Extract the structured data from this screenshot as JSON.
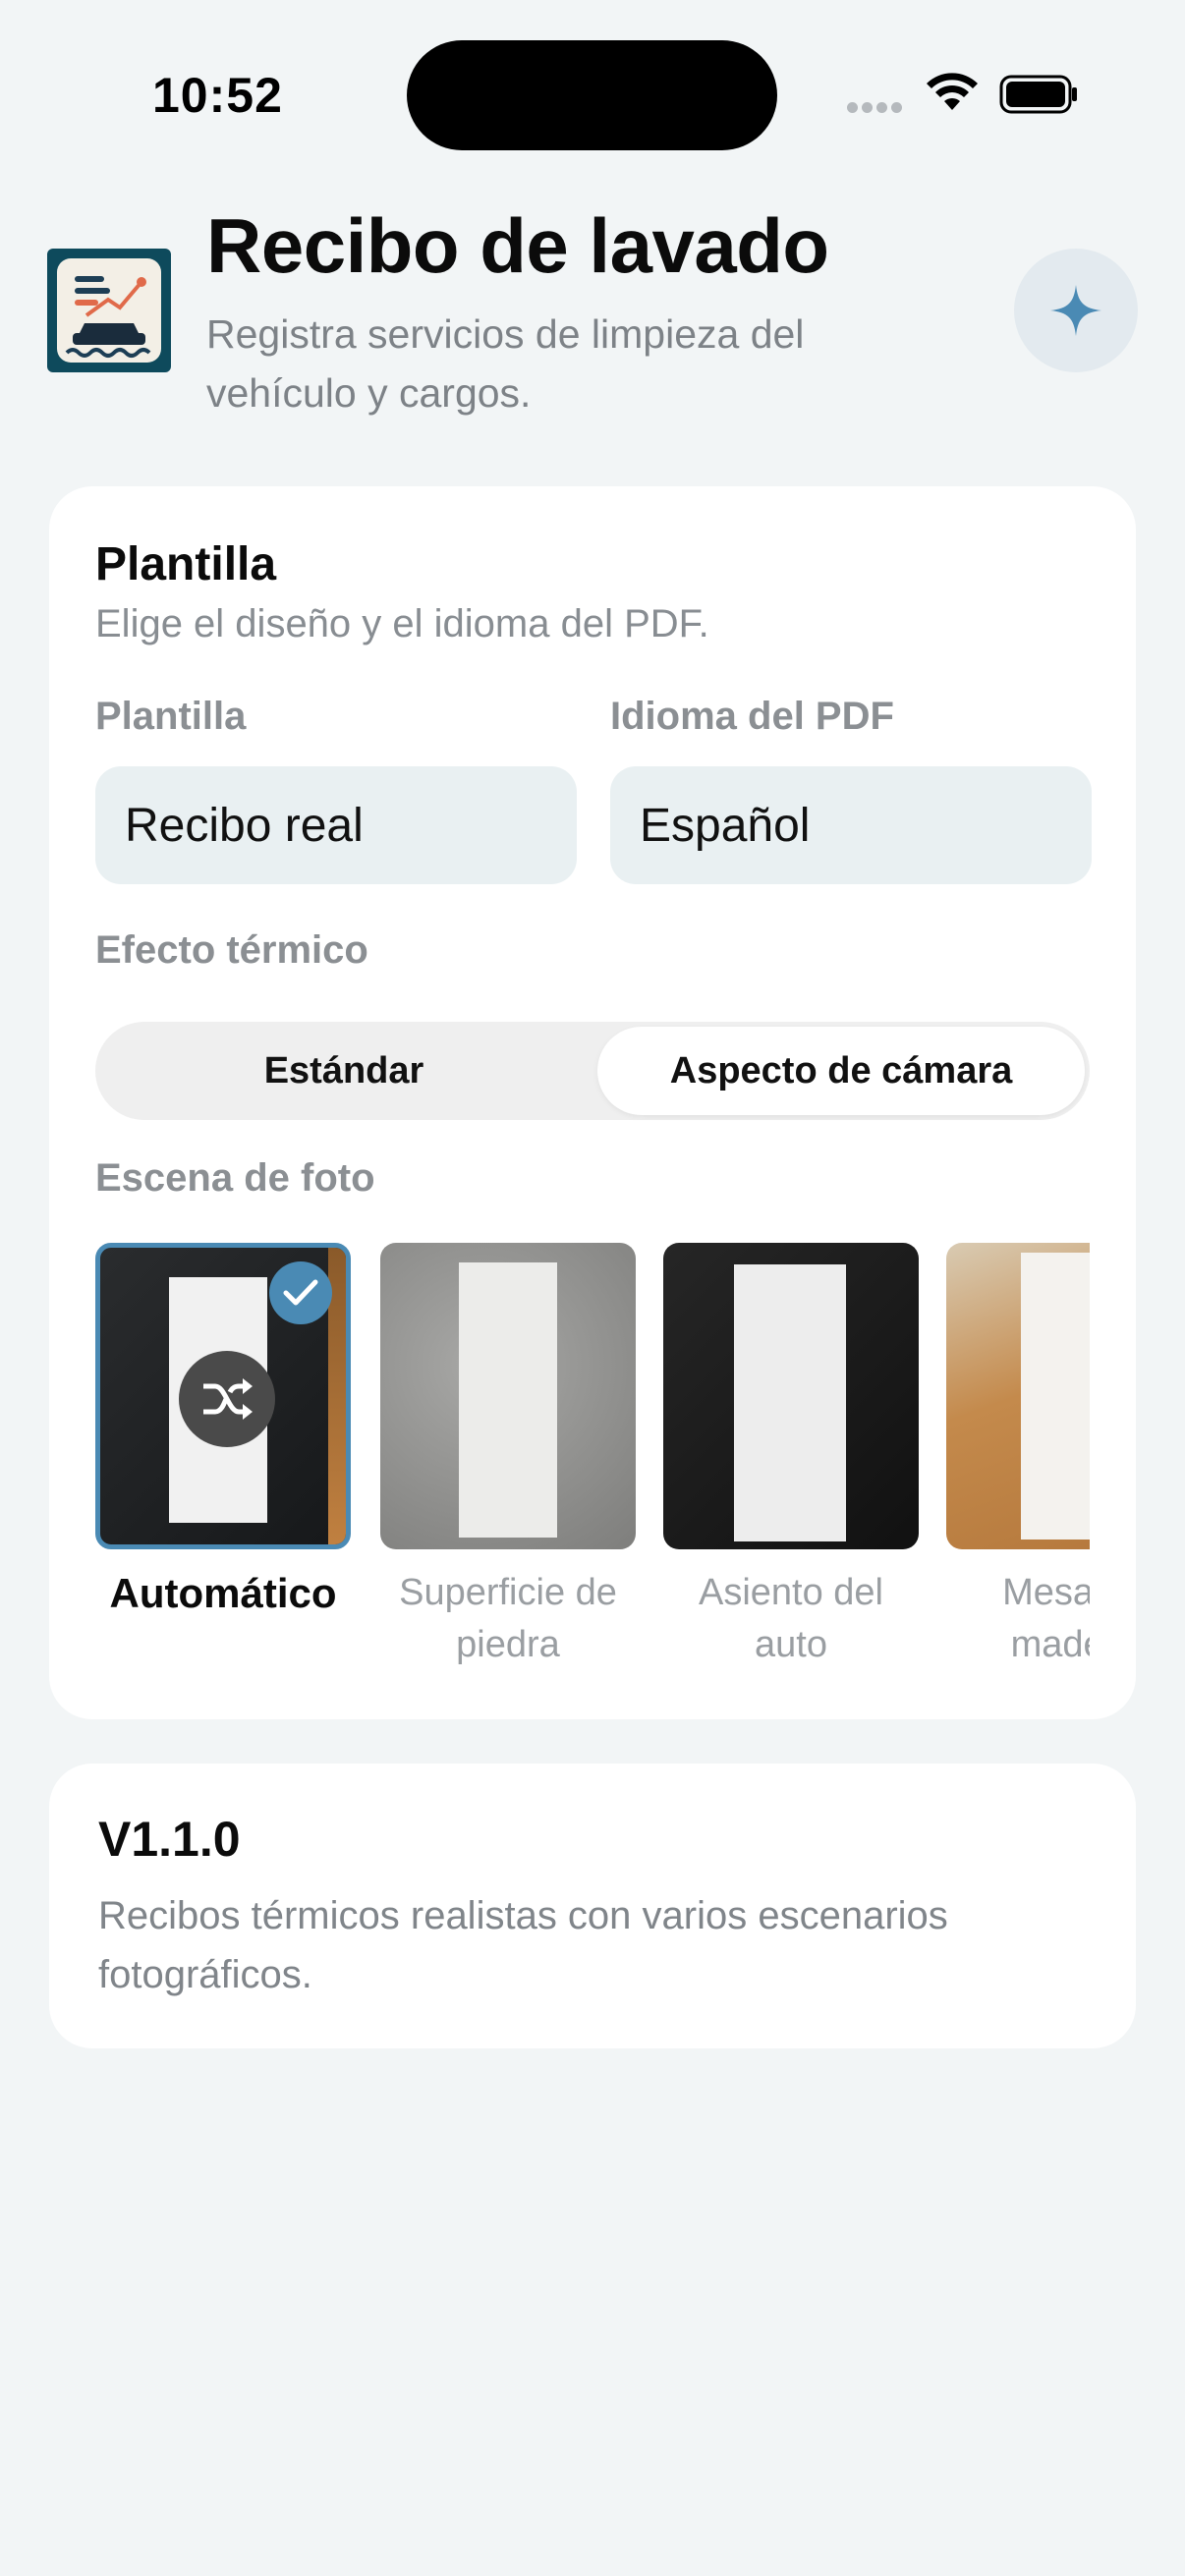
{
  "status_bar": {
    "time": "10:52"
  },
  "header": {
    "title": "Recibo de lavado",
    "subtitle": "Registra servicios de limpieza del vehículo y cargos."
  },
  "template_card": {
    "title": "Plantilla",
    "description": "Elige el diseño y el idioma del PDF.",
    "template_label": "Plantilla",
    "template_value": "Recibo real",
    "language_label": "Idioma del PDF",
    "language_value": "Español",
    "thermal_label": "Efecto térmico",
    "thermal_options": [
      "Estándar",
      "Aspecto de cámara"
    ],
    "thermal_selected": "Aspecto de cámara",
    "scene_label": "Escena de foto",
    "scenes": [
      {
        "label": "Automático",
        "selected": true
      },
      {
        "label": "Superficie de piedra",
        "selected": false
      },
      {
        "label": "Asiento del auto",
        "selected": false
      },
      {
        "label": "Mesa de madera",
        "selected": false
      }
    ]
  },
  "version_card": {
    "title": "V1.1.0",
    "description": "Recibos térmicos realistas con varios escenarios fotográficos."
  },
  "colors": {
    "accent": "#4a8ab4",
    "background": "#f2f5f6",
    "field_bg": "#e9f0f2"
  }
}
